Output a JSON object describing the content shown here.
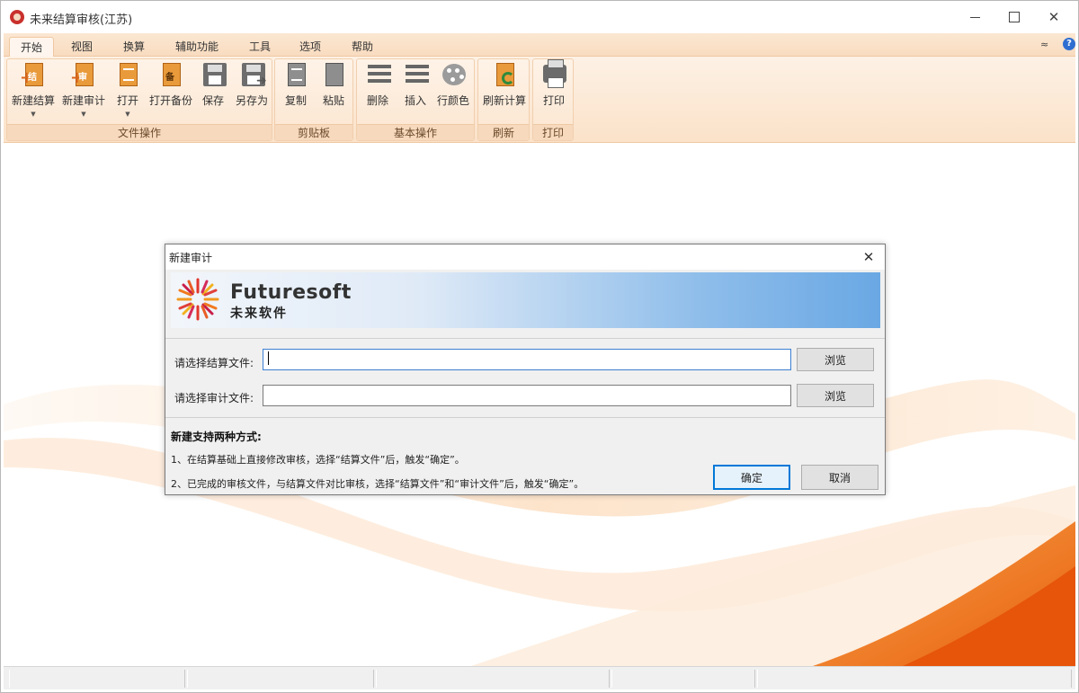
{
  "window": {
    "title": "未来结算审核(江苏)",
    "icon": "app-logo-icon"
  },
  "ribbon": {
    "tabs": [
      {
        "label": "开始",
        "active": true
      },
      {
        "label": "视图"
      },
      {
        "label": "换算"
      },
      {
        "label": "辅助功能"
      },
      {
        "label": "工具"
      },
      {
        "label": "选项"
      },
      {
        "label": "帮助"
      }
    ],
    "collapse_glyph": "≈",
    "help_glyph": "?",
    "groups": [
      {
        "label": "文件操作",
        "buttons": [
          {
            "label": "新建结算",
            "icon": "new-settlement-icon",
            "icon_char": "结",
            "dropdown": true
          },
          {
            "label": "新建审计",
            "icon": "new-audit-icon",
            "icon_char": "审",
            "dropdown": true
          },
          {
            "label": "打开",
            "icon": "open-icon",
            "dropdown": true
          },
          {
            "label": "打开备份",
            "icon": "open-backup-icon",
            "icon_char": "备"
          },
          {
            "label": "保存",
            "icon": "save-icon"
          },
          {
            "label": "另存为",
            "icon": "save-as-icon"
          }
        ]
      },
      {
        "label": "剪贴板",
        "buttons": [
          {
            "label": "复制",
            "icon": "copy-icon"
          },
          {
            "label": "粘贴",
            "icon": "paste-icon"
          }
        ]
      },
      {
        "label": "基本操作",
        "buttons": [
          {
            "label": "删除",
            "icon": "delete-row-icon"
          },
          {
            "label": "插入",
            "icon": "insert-row-icon"
          },
          {
            "label": "行颜色",
            "icon": "palette-icon"
          }
        ]
      },
      {
        "label": "刷新",
        "buttons": [
          {
            "label": "刷新计算",
            "icon": "refresh-calc-icon"
          }
        ]
      },
      {
        "label": "打印",
        "buttons": [
          {
            "label": "打印",
            "icon": "printer-icon"
          }
        ]
      }
    ]
  },
  "dialog": {
    "title": "新建审计",
    "brand_en": "Futuresoft",
    "brand_cn": "未来软件",
    "fields": [
      {
        "label": "请选择结算文件:",
        "value": "",
        "browse_label": "浏览"
      },
      {
        "label": "请选择审计文件:",
        "value": "",
        "browse_label": "浏览"
      }
    ],
    "info_title": "新建支持两种方式:",
    "info_lines": [
      "1、在结算基础上直接修改审核，选择“结算文件”后，触发“确定”。",
      "2、已完成的审核文件，与结算文件对比审核，选择“结算文件”和“审计文件”后，触发“确定”。"
    ],
    "ok_label": "确定",
    "cancel_label": "取消"
  },
  "colors": {
    "ribbon_bg": "#fbe2c9",
    "accent_orange": "#e99a3a",
    "dialog_bg": "#f0f0f0",
    "focus_blue": "#0078d7"
  }
}
